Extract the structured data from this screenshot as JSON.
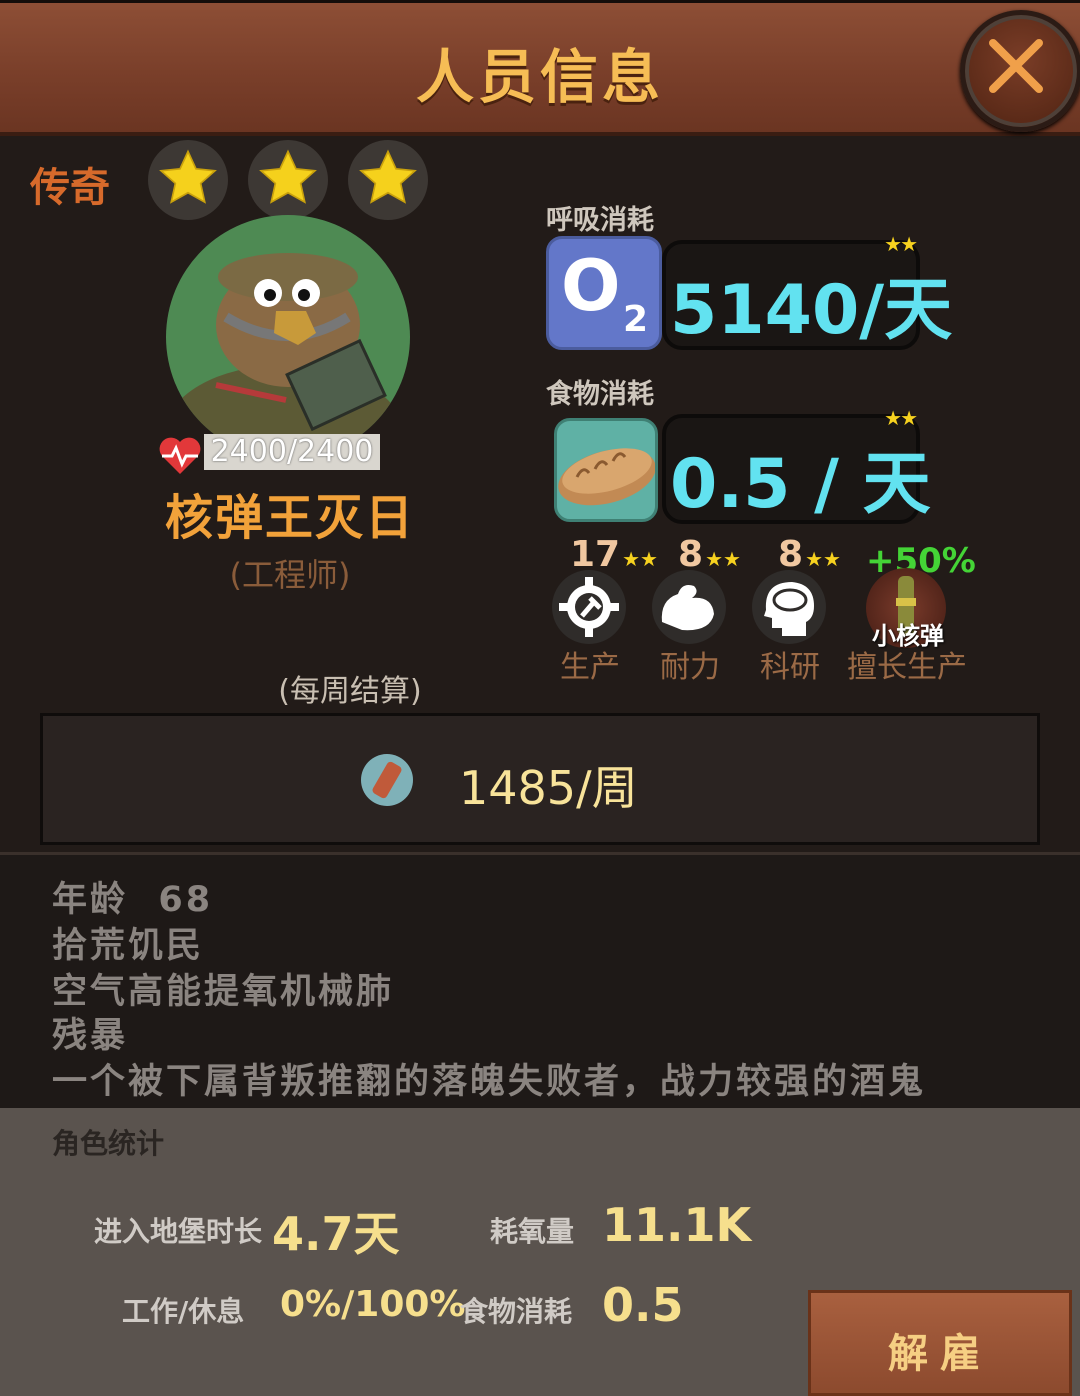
{
  "header": {
    "title": "人员信息"
  },
  "profile": {
    "rank": "传奇",
    "star_count": 3,
    "hp": "2400/2400",
    "name": "核弹王灭日",
    "profession": "(工程师)",
    "settlement_note": "(每周结算)"
  },
  "consumption": {
    "oxygen": {
      "label": "呼吸消耗",
      "icon_text": "O",
      "icon_sub": "2",
      "value": "5140/天",
      "stars": "★★"
    },
    "food": {
      "label": "食物消耗",
      "value": "0.5 / 天",
      "stars": "★★"
    }
  },
  "skills": [
    {
      "value": "17",
      "stars": "★★",
      "label": "生产",
      "icon": "gear-hammer-icon"
    },
    {
      "value": "8",
      "stars": "★★",
      "label": "耐力",
      "icon": "muscle-arm-icon"
    },
    {
      "value": "8",
      "stars": "★★",
      "label": "科研",
      "icon": "brain-head-icon"
    }
  ],
  "specialty": {
    "bonus": "+50%",
    "caption": "小核弹",
    "label": "擅长生产"
  },
  "weekly": {
    "value": "1485/周"
  },
  "description": {
    "age_label": "年龄",
    "age_value": "68",
    "origin": "拾荒饥民",
    "trait": "空气高能提氧机械肺",
    "personality": "残暴",
    "bio": "一个被下属背叛推翻的落魄失败者，战力较强的酒鬼"
  },
  "stats": {
    "title": "角色统计",
    "time_in_bunker_label": "进入地堡时长",
    "time_in_bunker_value": "4.7天",
    "oxygen_used_label": "耗氧量",
    "oxygen_used_value": "11.1K",
    "work_rest_label": "工作/休息",
    "work_rest_value": "0%/100%",
    "food_used_label": "食物消耗",
    "food_used_value": "0.5"
  },
  "actions": {
    "fire_label": "解雇"
  },
  "colors": {
    "accent": "#f6bd55",
    "cyan": "#62e2f0",
    "star": "#f7d21f",
    "bonus": "#44d436"
  }
}
